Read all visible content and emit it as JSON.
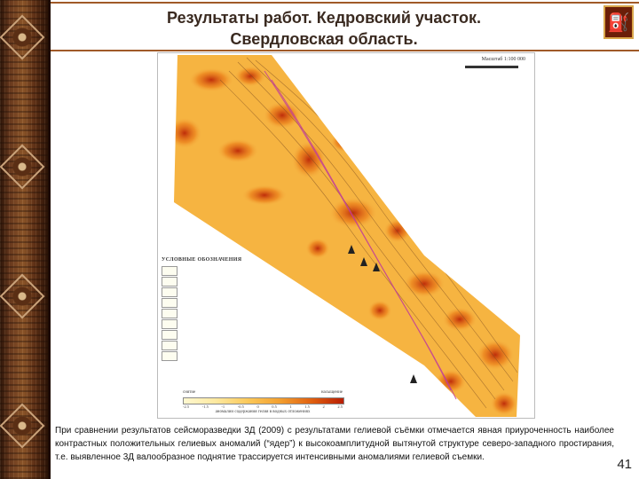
{
  "header": {
    "title_line1": "Результаты работ. Кедровский участок.",
    "title_line2": "Свердловская область.",
    "logo_icon": "oil-derrick-icon"
  },
  "map": {
    "scale_label": "Масштаб 1:100 000",
    "legend_title": "УСЛОВНЫЕ ОБОЗНАЧЕНИЯ",
    "colorbar_labels": {
      "low": "снятие",
      "high": "насыщение"
    },
    "colorbar_ticks": [
      "-2.5",
      "-1.5",
      "-1",
      "-0.5",
      "0",
      "0.5",
      "1",
      "1.5",
      "2",
      "2.5"
    ],
    "colorbar_caption": "аномалии содержания гелия в водных отложениях"
  },
  "body_text": "При сравнении результатов сейсморазведки 3Д (2009) с результатами гелиевой съёмки отмечается явная приуроченность наиболее контрастных положительных гелиевых аномалий (“ядер”) к высокоамплитудной вытянутой структуре северо-западного простирания, т.е. выявленное 3Д валообразное поднятие трассируется интенсивными аномалиями гелиевой съемки.",
  "page_number": "41",
  "colors": {
    "accent": "#a05a28",
    "map_low": "#fde9a0",
    "map_high": "#c8260a"
  }
}
